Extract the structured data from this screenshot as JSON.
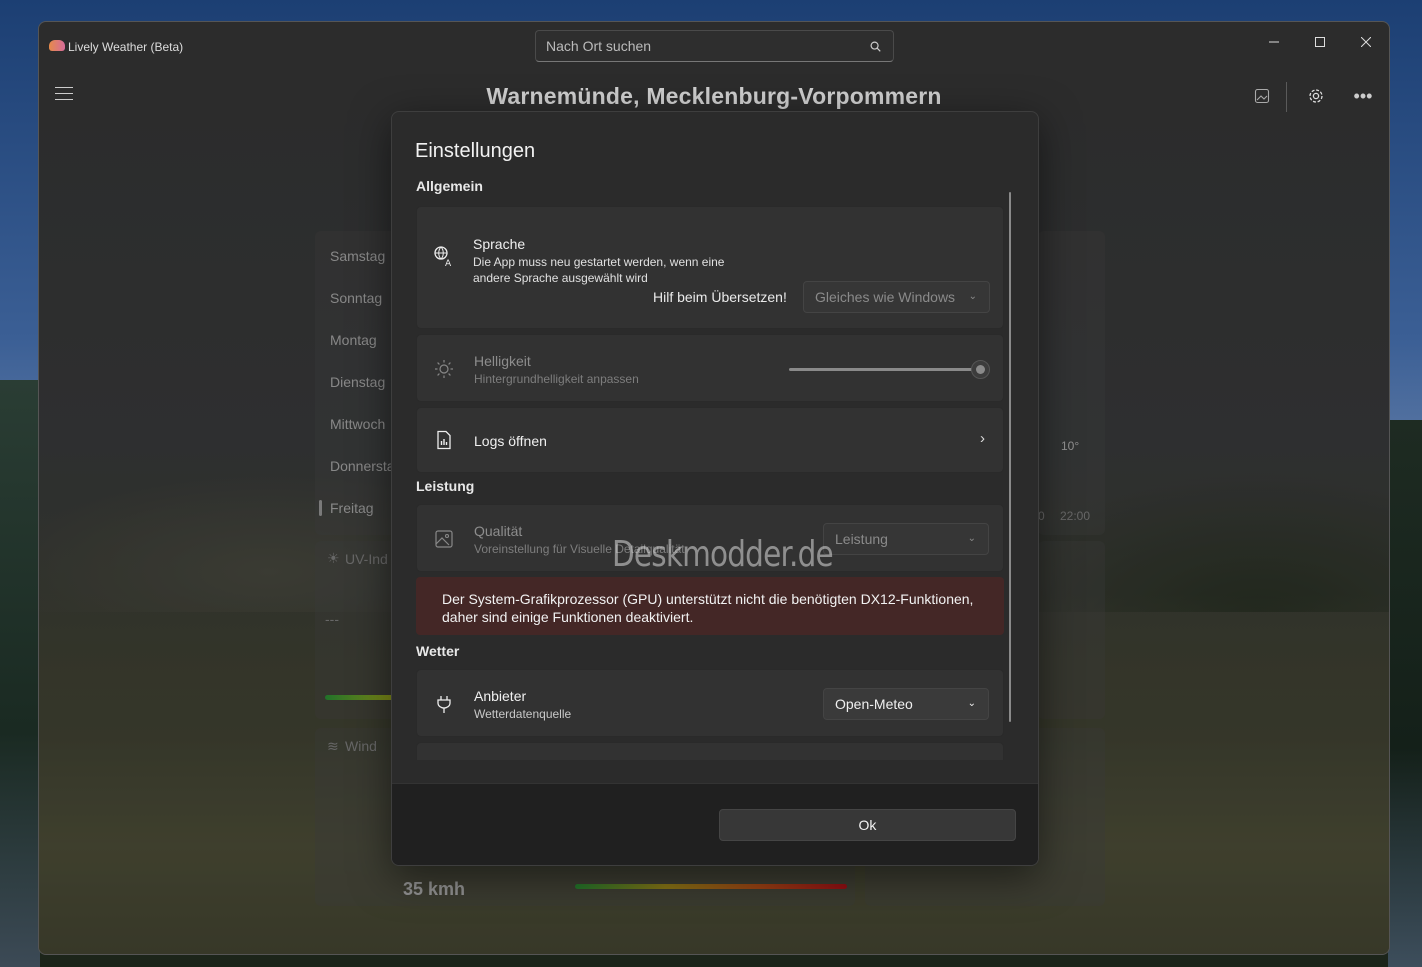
{
  "window": {
    "app_title": "Lively Weather (Beta)",
    "search_placeholder": "Nach Ort suchen",
    "location": "Warnemünde, Mecklenburg-Vorpommern"
  },
  "background": {
    "days": [
      "Samstag",
      "Sonntag",
      "Montag",
      "Dienstag",
      "Mittwoch",
      "Donnersta",
      "Freitag"
    ],
    "uv_label": "UV-Ind",
    "uv_value": "---",
    "wind_label": "Wind",
    "wind_speed": "35 kmh",
    "temp": "10°",
    "time_partial": "0",
    "time": "22:00"
  },
  "dialog": {
    "title": "Einstellungen",
    "sections": {
      "general": "Allgemein",
      "performance": "Leistung",
      "weather": "Wetter"
    },
    "language": {
      "title": "Sprache",
      "subtitle_line1": "Die App muss neu gestartet werden, wenn eine",
      "subtitle_line2": "andere Sprache ausgewählt wird",
      "help_link": "Hilf beim Übersetzen!",
      "value": "Gleiches wie Windows"
    },
    "brightness": {
      "title": "Helligkeit",
      "subtitle": "Hintergrundhelligkeit anpassen",
      "level": 1.0
    },
    "logs": {
      "title": "Logs öffnen"
    },
    "quality": {
      "title": "Qualität",
      "subtitle": "Voreinstellung für Visuelle Detailqualität",
      "value": "Leistung"
    },
    "gpu_error_line1": "Der System-Grafikprozessor (GPU) unterstützt nicht die benötigten DX12-Funktionen,",
    "gpu_error_line2": "daher sind einige Funktionen deaktiviert.",
    "provider": {
      "title": "Anbieter",
      "subtitle": "Wetterdatenquelle",
      "value": "Open-Meteo"
    },
    "ok_label": "Ok"
  },
  "watermark": "Deskmodder.de",
  "colors": {
    "error_background": "#442726",
    "dialog_background": "#2b2b2b"
  }
}
